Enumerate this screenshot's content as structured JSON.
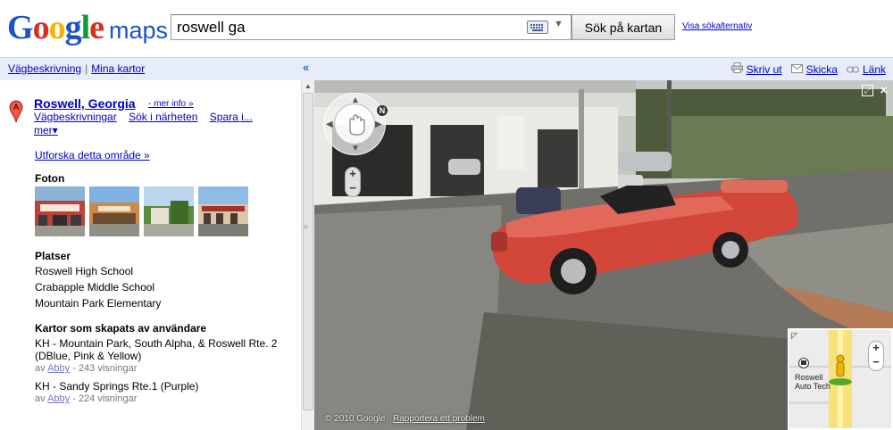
{
  "header": {
    "logo_google": "Google",
    "logo_maps": "maps",
    "search_value": "roswell ga",
    "search_button": "Sök på kartan",
    "search_options": "Visa sökalternativ",
    "logo_colors": [
      "#1a53c7",
      "#d92d1f",
      "#f5b401",
      "#1a53c7",
      "#0c9a35",
      "#d92d1f"
    ]
  },
  "topbar": {
    "directions": "Vägbeskrivning",
    "my_maps": "Mina kartor",
    "collapse_icon": "«",
    "print": "Skriv ut",
    "send": "Skicka",
    "link": "Länk"
  },
  "place": {
    "marker_letter": "A",
    "title": "Roswell, Georgia",
    "more_info": "- mer info »",
    "links": [
      "Vägbeskrivningar",
      "Sök i närheten",
      "Spara i...",
      "mer▾"
    ],
    "explore": "Utforska detta område »"
  },
  "photos": {
    "title": "Foton",
    "items": [
      "photo-1",
      "photo-2",
      "photo-3",
      "photo-4"
    ]
  },
  "places": {
    "title": "Platser",
    "items": [
      "Roswell High School",
      "Crabapple Middle School",
      "Mountain Park Elementary"
    ]
  },
  "user_maps": {
    "title": "Kartor som skapats av användare",
    "items": [
      {
        "line1": "KH - Mountain Park, South Alpha, & Roswell Rte. 2",
        "line2": "(DBlue, Pink & Yellow)",
        "by": "av",
        "author": "Abby",
        "views": "- 243 visningar"
      },
      {
        "line1": "KH - Sandy Springs Rte.1 (Purple)",
        "line2": "",
        "by": "av",
        "author": "Abby",
        "views": "- 224 visningar"
      }
    ]
  },
  "streetview": {
    "compass": "N",
    "zoom_in": "+",
    "zoom_out": "−",
    "close": "×",
    "copyright": "© 2010 Google",
    "report": "Rapportera ett problem",
    "minimap_label": "Roswell Auto Tech",
    "minimap_zoom_in": "+",
    "minimap_zoom_out": "−"
  }
}
